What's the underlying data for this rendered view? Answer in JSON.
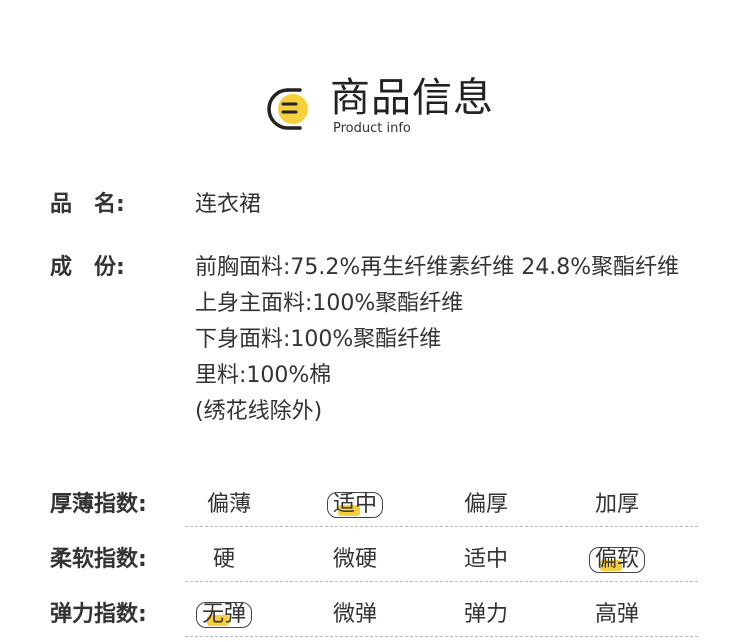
{
  "header": {
    "title_cn": "商品信息",
    "title_en": "Product info",
    "icon": "document-lines-icon",
    "accent_color": "#f7cf3a"
  },
  "info": {
    "name_label": "品　名:",
    "name_value": "连衣裙",
    "composition_label": "成　份:",
    "composition_lines": [
      "前胸面料:75.2%再生纤维素纤维 24.8%聚酯纤维",
      "上身主面料:100%聚酯纤维",
      "下身面料:100%聚酯纤维",
      "里料:100%棉",
      "(绣花线除外)"
    ]
  },
  "indices": [
    {
      "label": "厚薄指数:",
      "options": [
        "偏薄",
        "适中",
        "偏厚",
        "加厚"
      ],
      "selected": "适中"
    },
    {
      "label": "柔软指数:",
      "options": [
        "硬",
        "微硬",
        "适中",
        "偏软"
      ],
      "selected": "偏软"
    },
    {
      "label": "弹力指数:",
      "options": [
        "无弹",
        "微弹",
        "弹力",
        "高弹"
      ],
      "selected": "无弹"
    }
  ]
}
